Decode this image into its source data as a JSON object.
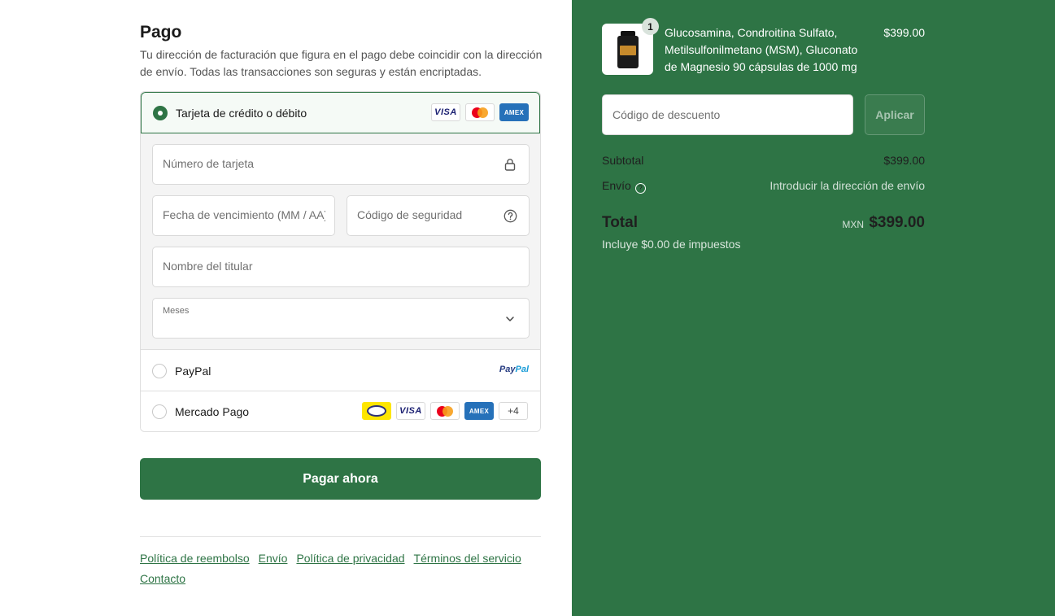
{
  "payment": {
    "title": "Pago",
    "description": "Tu dirección de facturación que figura en el pago debe coincidir con la dirección de envío. Todas las transacciones son seguras y están encriptadas.",
    "card_option": {
      "label": "Tarjeta de crédito o débito",
      "selected": true,
      "logos": [
        "VISA",
        "mastercard",
        "AMEX"
      ]
    },
    "card_form": {
      "card_number_placeholder": "Número de tarjeta",
      "expiry_placeholder": "Fecha de vencimiento (MM / AA)",
      "security_code_placeholder": "Código de seguridad",
      "holder_name_placeholder": "Nombre del titular",
      "months_label": "Meses",
      "months_value": ""
    },
    "paypal_option": {
      "label": "PayPal",
      "logo_a": "Pay",
      "logo_b": "Pal"
    },
    "mercadopago_option": {
      "label": "Mercado Pago",
      "more_count": "+4"
    },
    "pay_button_label": "Pagar ahora"
  },
  "footer": {
    "links": [
      "Política de reembolso",
      "Envío",
      "Política de privacidad",
      "Términos del servicio",
      "Contacto"
    ]
  },
  "summary": {
    "product": {
      "quantity": "1",
      "name": "Glucosamina, Condroitina Sulfato, Metilsulfonilmetano (MSM), Gluconato de Magnesio 90 cápsulas de 1000 mg",
      "price": "$399.00"
    },
    "discount_placeholder": "Código de descuento",
    "apply_label": "Aplicar",
    "subtotal_label": "Subtotal",
    "subtotal_value": "$399.00",
    "shipping_label": "Envío",
    "shipping_value": "Introducir la dirección de envío",
    "total_label": "Total",
    "total_currency": "MXN",
    "total_value": "$399.00",
    "tax_note": "Incluye $0.00 de impuestos"
  },
  "colors": {
    "brand_green": "#2e7445",
    "white": "#ffffff"
  }
}
